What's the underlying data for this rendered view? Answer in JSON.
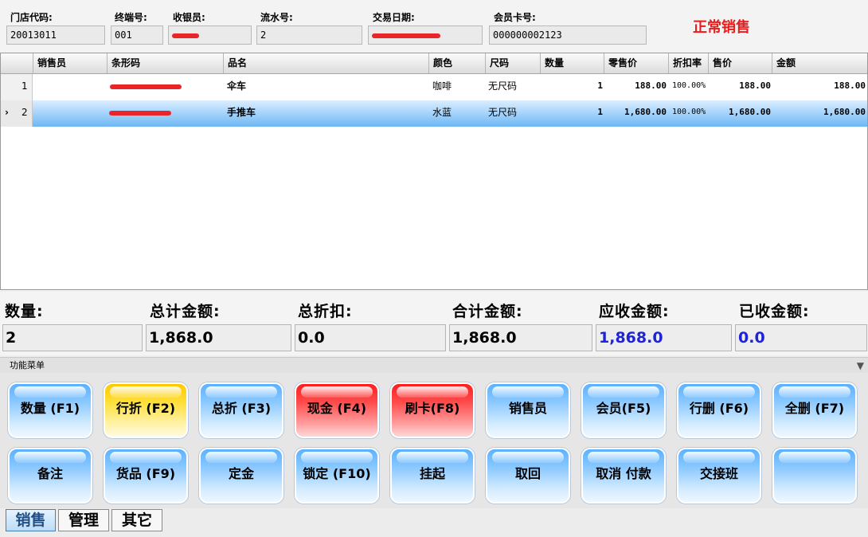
{
  "header": {
    "store_code_label": "门店代码:",
    "store_code": "20013011",
    "terminal_label": "终端号:",
    "terminal": "001",
    "cashier_label": "收银员:",
    "serial_label": "流水号:",
    "serial": "2",
    "trade_date_label": "交易日期:",
    "member_card_label": "会员卡号:",
    "member_card": "000000002123",
    "mode_title": "正常销售"
  },
  "grid": {
    "columns": [
      "销售员",
      "条形码",
      "品名",
      "颜色",
      "尺码",
      "数量",
      "零售价",
      "折扣率",
      "售价",
      "金额"
    ],
    "rows": [
      {
        "index": "1",
        "indicator": "",
        "salesperson": "",
        "name": "伞车",
        "color": "咖啡",
        "size": "无尺码",
        "qty": "1",
        "retail_price": "188.00",
        "discount": "100.00%",
        "price": "188.00",
        "amount": "188.00"
      },
      {
        "index": "2",
        "indicator": "›",
        "salesperson": "",
        "name": "手推车",
        "color": "水蓝",
        "size": "无尺码",
        "qty": "1",
        "retail_price": "1,680.00",
        "discount": "100.00%",
        "price": "1,680.00",
        "amount": "1,680.00"
      }
    ]
  },
  "totals": {
    "qty_label": "数量:",
    "qty": "2",
    "total_label": "总计金额:",
    "total": "1,868.0",
    "discount_label": "总折扣:",
    "discount": "0.0",
    "sum_label": "合计金额:",
    "sum": "1,868.0",
    "receivable_label": "应收金额:",
    "receivable": "1,868.0",
    "received_label": "已收金额:",
    "received": "0.0",
    "value_blue_color": "#1e24d6"
  },
  "menu": {
    "title": "功能菜单",
    "row1": [
      "数量 (F1)",
      "行折 (F2)",
      "总折 (F3)",
      "现金 (F4)",
      "刷卡(F8)",
      "销售员",
      "会员(F5)",
      "行删 (F6)",
      "全删 (F7)"
    ],
    "row2": [
      "备注",
      "货品 (F9)",
      "定金",
      "锁定 (F10)",
      "挂起",
      "取回",
      "取消 付款",
      "交接班",
      ""
    ]
  },
  "tabs": [
    "销售",
    "管理",
    "其它"
  ],
  "colors": {
    "mode_title": "#e81c1c",
    "selected_row": "#9fd0fa",
    "button_blue": "#5ab1ff",
    "button_yellow": "#ffc800",
    "button_red": "#ff1e1e"
  }
}
